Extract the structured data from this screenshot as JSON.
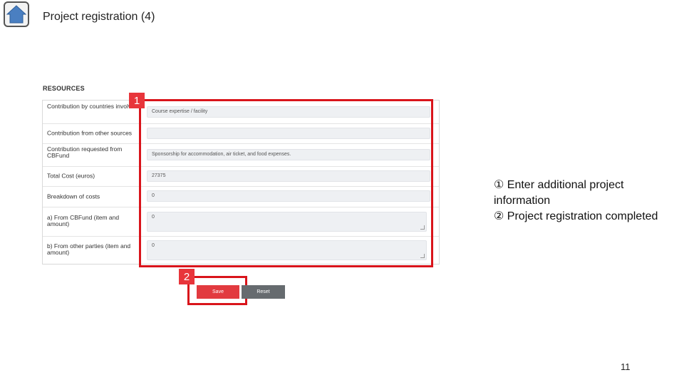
{
  "slide": {
    "title": "Project registration (4)",
    "page_number": "11"
  },
  "form": {
    "section_title": "RESOURCES",
    "rows": [
      {
        "label": "Contribution by countries involved",
        "value": "Course expertise / facility"
      },
      {
        "label": "Contribution from other sources",
        "value": ""
      },
      {
        "label": "Contribution requested from CBFund",
        "value": "Sponsorship for accommodation, air ticket, and food expenses."
      },
      {
        "label": "Total Cost (euros)",
        "value": "27375"
      },
      {
        "label": "Breakdown of costs",
        "value": "0"
      },
      {
        "label": "a) From CBFund (item and amount)",
        "value": "0"
      },
      {
        "label": "b) From other parties (item and amount)",
        "value": "0"
      }
    ],
    "save_label": "Save",
    "reset_label": "Reset"
  },
  "annotations": {
    "badge_1": "1",
    "badge_2": "2",
    "notes": [
      "① Enter additional project information",
      "② Project registration completed"
    ]
  },
  "colors": {
    "highlight": "#d9141b",
    "badge": "#e8353b",
    "save_button": "#e23a3f",
    "reset_button": "#666b6f"
  },
  "icons": {
    "home": "home-icon"
  }
}
